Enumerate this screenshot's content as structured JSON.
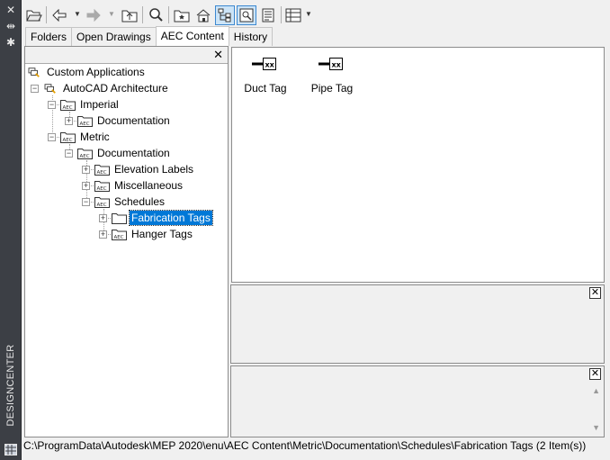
{
  "sidebar": {
    "title": "DESIGNCENTER"
  },
  "tabs": [
    {
      "label": "Folders"
    },
    {
      "label": "Open Drawings"
    },
    {
      "label": "AEC Content"
    },
    {
      "label": "History"
    }
  ],
  "tree": {
    "items": [
      {
        "label": "Custom Applications"
      },
      {
        "label": "AutoCAD Architecture"
      },
      {
        "label": "Imperial"
      },
      {
        "label": "Documentation"
      },
      {
        "label": "Metric"
      },
      {
        "label": "Documentation"
      },
      {
        "label": "Elevation Labels"
      },
      {
        "label": "Miscellaneous"
      },
      {
        "label": "Schedules"
      },
      {
        "label": "Fabrication Tags"
      },
      {
        "label": "Hanger Tags"
      }
    ]
  },
  "content": {
    "items": [
      {
        "label": "Duct Tag",
        "icon_text": "xx"
      },
      {
        "label": "Pipe Tag",
        "icon_text": "xx"
      }
    ]
  },
  "status": "C:\\ProgramData\\Autodesk\\MEP 2020\\enu\\AEC Content\\Metric\\Documentation\\Schedules\\Fabrication Tags (2 Item(s))",
  "colors": {
    "selection": "#0078d7",
    "sidebar": "#3c3f45",
    "active_button": "#cce4f7"
  }
}
